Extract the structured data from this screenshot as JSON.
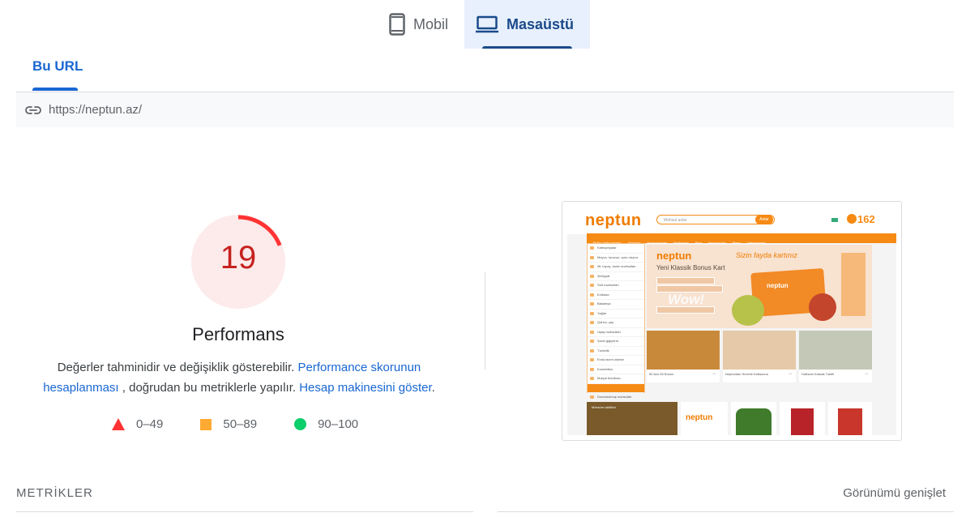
{
  "device_tabs": {
    "mobile_label": "Mobil",
    "desktop_label": "Masaüstü",
    "active": "desktop"
  },
  "url_tab": {
    "label": "Bu URL"
  },
  "url": {
    "value": "https://neptun.az/"
  },
  "performance": {
    "score": "19",
    "score_fraction": 0.19,
    "title": "Performans",
    "desc_part1": "Değerler tahminidir ve değişiklik gösterebilir.",
    "link_scoring": "Performance skorunun hesaplanması",
    "desc_part2": ", doğrudan bu metriklerle yapılır.",
    "link_calculator": "Hesap makinesini göster",
    "colors": {
      "fail": "#ff3333",
      "fail_bg": "#fdeaea",
      "fail_text": "#c5221f",
      "average": "#ffaa33",
      "pass": "#0cce6b"
    }
  },
  "legend": {
    "fail_range": "0–49",
    "average_range": "50–89",
    "pass_range": "90–100"
  },
  "thumbnail": {
    "logo": "neptun",
    "search_placeholder": "Məhsul axtar",
    "search_button": "Axtar",
    "hotline": "162",
    "nav_items": [
      "Bütün kateqoriyalar",
      "Aksiyalar",
      "Kampaniyalar",
      "Mağazalar",
      "Bloq",
      "Haqqımızda",
      "Əlaqə",
      "Vakansiyalar"
    ],
    "sidebar_items": [
      "Kateqoriyalar",
      "Meyvə, tərəvəz, quru meyvə",
      "Ət, toyuq, dəniz məhsulları",
      "Şirniyyat",
      "Süd məhsulları",
      "Kolbasa",
      "Bakaleya",
      "Yağlar",
      "Qəhvə, çay",
      "Uşaq məhsulları",
      "Şəxsi gigiyena",
      "Təmizlik",
      "Evdə lazım olanlar",
      "Kosmetika",
      "Məişət texnikası",
      "Ev heyvanları",
      "Dondurulmuş məhsullar"
    ],
    "banner_script": "Sizin fayda kartınız",
    "banner_title": "Yeni Klassik Bonus Kart",
    "banner_wow": "Wow!",
    "banner_card_logo": "neptun",
    "cards": [
      {
        "caption": "50 Azn 50 Bonus"
      },
      {
        "caption": "Neptundan Sevimli Həftəsonu"
      },
      {
        "caption": "Həftənin Klassik Təklifi"
      }
    ],
    "products": [
      "Mövsüm təklifləri",
      "neptun",
      "",
      "",
      ""
    ]
  },
  "metrics": {
    "label": "METRİKLER",
    "expand_label": "Görünümü genişlet"
  }
}
